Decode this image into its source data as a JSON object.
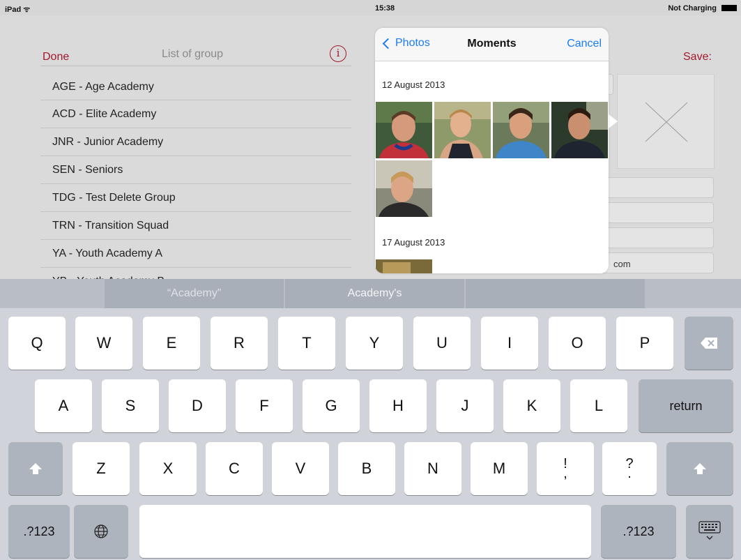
{
  "status_bar": {
    "device": "iPad ᯤ",
    "time": "15:38",
    "battery": "Not Charging"
  },
  "left_panel": {
    "done": "Done",
    "title": "List of group",
    "info": "i",
    "groups": [
      "AGE - Age Academy",
      "ACD - Elite Academy",
      "JNR - Junior Academy",
      "SEN - Seniors",
      "TDG - Test Delete Group",
      "TRN - Transition Squad",
      "YA - Youth Academy A",
      "YB - Youth Academy B"
    ]
  },
  "right_panel": {
    "save": "Save:",
    "email_suffix": "com"
  },
  "popover": {
    "back": "Photos",
    "title": "Moments",
    "cancel": "Cancel",
    "sections": [
      {
        "date": "12 August 2013",
        "photo_count": 5
      },
      {
        "date": "17 August 2013",
        "photo_count": 1
      }
    ]
  },
  "keyboard": {
    "suggestions": [
      "“Academy”",
      "Academy's",
      ""
    ],
    "row1": [
      "Q",
      "W",
      "E",
      "R",
      "T",
      "Y",
      "U",
      "I",
      "O",
      "P"
    ],
    "row2": [
      "A",
      "S",
      "D",
      "F",
      "G",
      "H",
      "J",
      "K",
      "L"
    ],
    "row3": [
      "Z",
      "X",
      "C",
      "V",
      "B",
      "N",
      "M"
    ],
    "punct1": [
      "!",
      ","
    ],
    "punct2": [
      "?",
      "."
    ],
    "return": "return",
    "numbers_left": ".?123",
    "numbers_right": ".?123",
    "icons": {
      "delete": "backspace-icon",
      "shift": "shift-icon",
      "globe": "globe-icon",
      "dismiss": "keyboard-dismiss-icon"
    }
  },
  "colors": {
    "accent_red": "#a0192c",
    "ios_blue": "#1a7cf5"
  }
}
